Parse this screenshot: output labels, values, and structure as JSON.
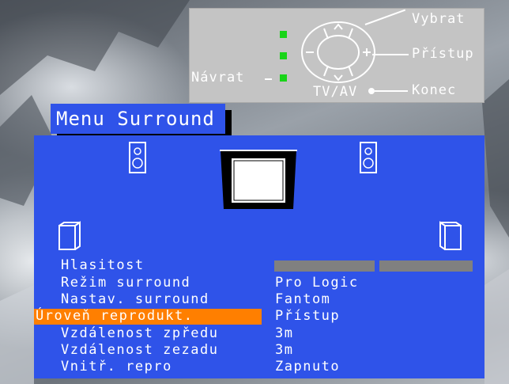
{
  "keypanel": {
    "select_label": "Vybrat",
    "access_label": "Přístup",
    "back_label": "Návrat",
    "tvav_label": "TV/AV",
    "exit_label": "Konec"
  },
  "menu": {
    "title": "Menu Surround",
    "rows": [
      {
        "label": "Hlasitost",
        "value": ""
      },
      {
        "label": "Režim surround",
        "value": "Pro Logic"
      },
      {
        "label": "Nastav. surround",
        "value": "Fantom"
      },
      {
        "label": "Úroveň reprodukt.",
        "value": "Přístup"
      },
      {
        "label": "Vzdálenost zpředu",
        "value": "3m"
      },
      {
        "label": "Vzdálenost zezadu",
        "value": "3m"
      },
      {
        "label": "Vnitř. repro",
        "value": "Zapnuto"
      }
    ],
    "selected_row": "Úroveň reprodukt."
  },
  "colors": {
    "panel": "#2f53e9",
    "highlight": "#ff7f00",
    "indicator": "#19d419"
  },
  "icons": [
    "speaker-front-left-icon",
    "speaker-front-right-icon",
    "tv-icon",
    "speaker-rear-left-icon",
    "speaker-rear-right-icon",
    "remote-dpad-icon"
  ]
}
